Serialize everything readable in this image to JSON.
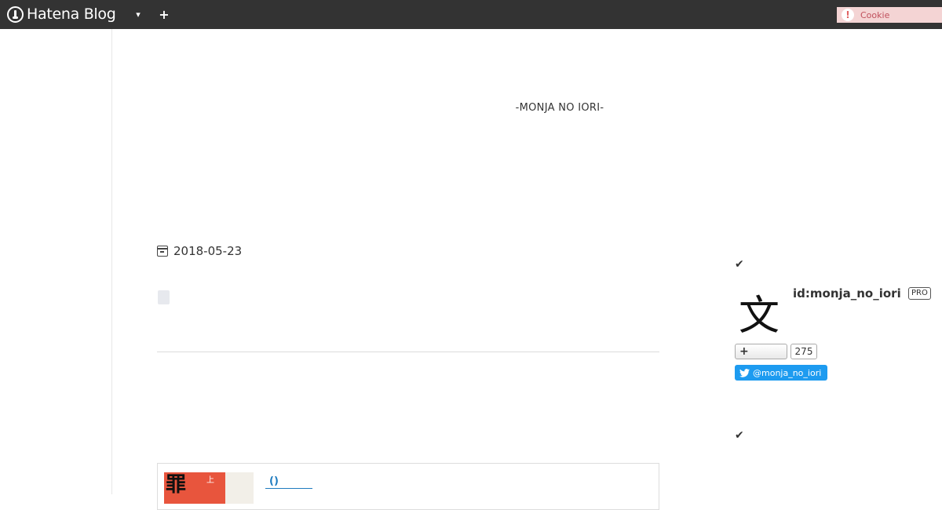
{
  "header": {
    "brand": "Hatena Blog",
    "menu_icon": "caret-down-icon",
    "add_icon": "plus-icon",
    "cookie_label": "Cookie",
    "cookie_icon": "exclamation-icon",
    "cookie_icon_glyph": "!"
  },
  "blog": {
    "title": "-MONJA NO IORI-"
  },
  "entry": {
    "date": "2018-05-23",
    "embed": {
      "title": "()",
      "thumb_glyph": "罪",
      "thumb_small": "上"
    }
  },
  "sidebar": {
    "check_glyph": "✔",
    "avatar_glyph": "文",
    "profile_id": "id:monja_no_iori",
    "pro_badge": "PRO",
    "follow_plus": "+",
    "follow_count": "275",
    "twitter_handle": "@monja_no_iori"
  },
  "colors": {
    "header_bg": "#333333",
    "cookie_bg": "#f4d4d4",
    "link": "#1e7bbf",
    "twitter": "#1d9bf0"
  }
}
